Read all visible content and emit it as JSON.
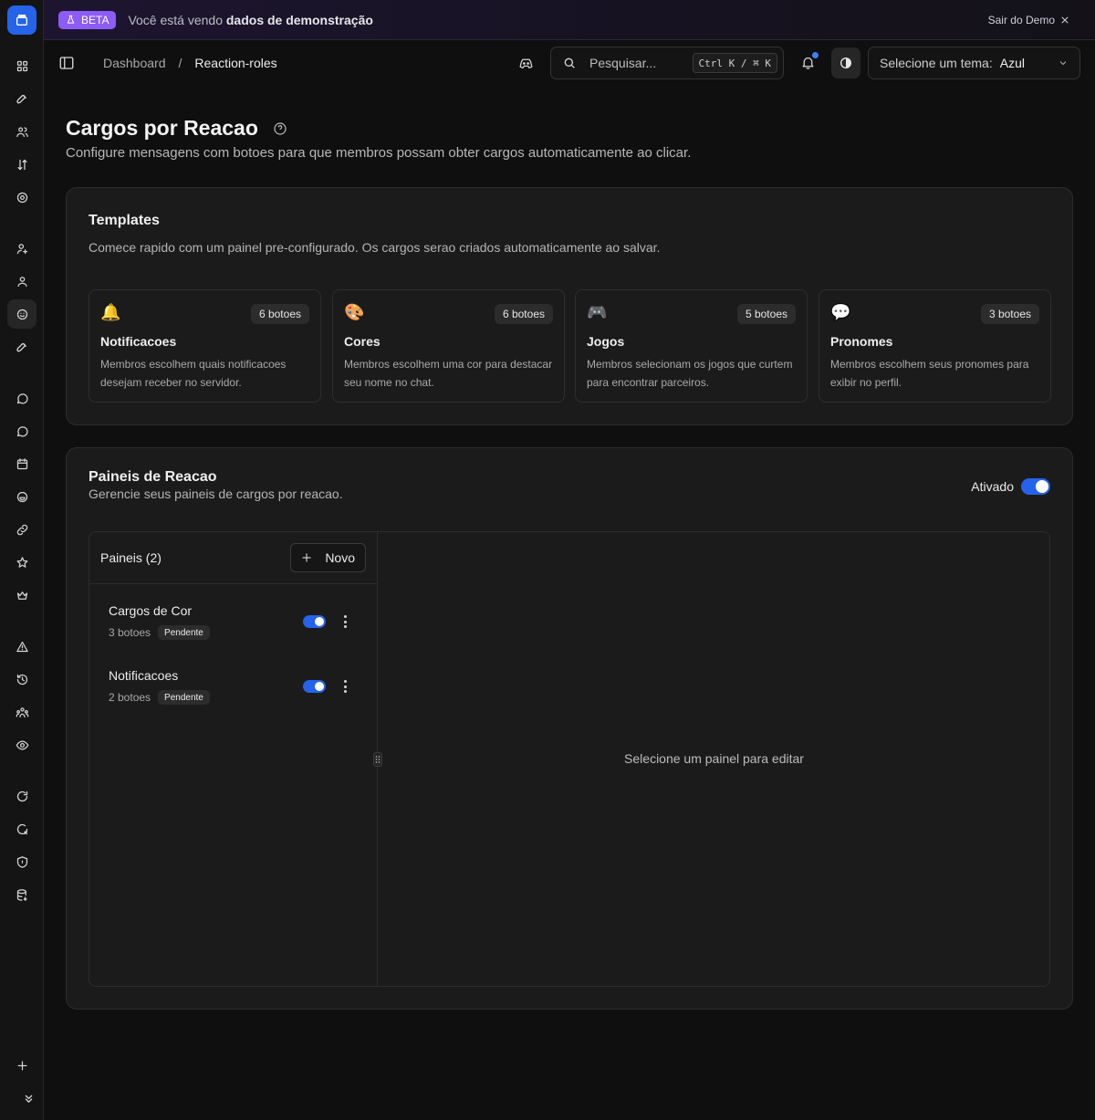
{
  "banner": {
    "beta_label": "BETA",
    "message_prefix": "Você está vendo",
    "message_bold": "dados de demonstração",
    "exit_label": "Sair do Demo"
  },
  "header": {
    "breadcrumb": [
      "Dashboard",
      "/",
      "Reaction-roles"
    ],
    "search_placeholder": "Pesquisar...",
    "search_shortcut": "Ctrl K / ⌘ K",
    "theme_label": "Selecione um tema:",
    "theme_value": "Azul"
  },
  "page": {
    "title": "Cargos por Reacao",
    "subtitle": "Configure mensagens com botoes para que membros possam obter cargos automaticamente ao clicar."
  },
  "templates": {
    "title": "Templates",
    "description": "Comece rapido com um painel pre-configurado. Os cargos serao criados automaticamente ao salvar.",
    "items": [
      {
        "emoji": "🔔",
        "badge": "6 botoes",
        "name": "Notificacoes",
        "desc": "Membros escolhem quais notificacoes desejam receber no servidor."
      },
      {
        "emoji": "🎨",
        "badge": "6 botoes",
        "name": "Cores",
        "desc": "Membros escolhem uma cor para destacar seu nome no chat."
      },
      {
        "emoji": "🎮",
        "badge": "5 botoes",
        "name": "Jogos",
        "desc": "Membros selecionam os jogos que curtem para encontrar parceiros."
      },
      {
        "emoji": "💬",
        "badge": "3 botoes",
        "name": "Pronomes",
        "desc": "Membros escolhem seus pronomes para exibir no perfil."
      }
    ]
  },
  "panels": {
    "title": "Paineis de Reacao",
    "description": "Gerencie seus paineis de cargos por reacao.",
    "enabled_label": "Ativado",
    "list_title": "Paineis (2)",
    "new_label": "Novo",
    "items": [
      {
        "name": "Cargos de Cor",
        "buttons": "3 botoes",
        "status": "Pendente"
      },
      {
        "name": "Notificacoes",
        "buttons": "2 botoes",
        "status": "Pendente"
      }
    ],
    "empty_message": "Selecione um painel para editar"
  },
  "colors": {
    "accent": "#2563eb",
    "beta": "#8b5cf6",
    "background": "#0f0f0f",
    "card": "#1b1b1b"
  },
  "sidebar_icons": [
    "grid-icon",
    "rocket-icon",
    "users-icon",
    "arrows-sort-icon",
    "settings-icon",
    "user-plus-icon",
    "user-icon",
    "smile-icon",
    "rocket-icon",
    "message-icon",
    "message-icon",
    "calendar-icon",
    "emoji-icon",
    "link-icon",
    "star-icon",
    "crown-icon",
    "alert-icon",
    "history-icon",
    "group-icon",
    "eye-icon",
    "refresh-shield-icon",
    "shield-x-icon",
    "shield-icon",
    "database-icon",
    "plus-icon",
    "chevrons-down-icon"
  ]
}
